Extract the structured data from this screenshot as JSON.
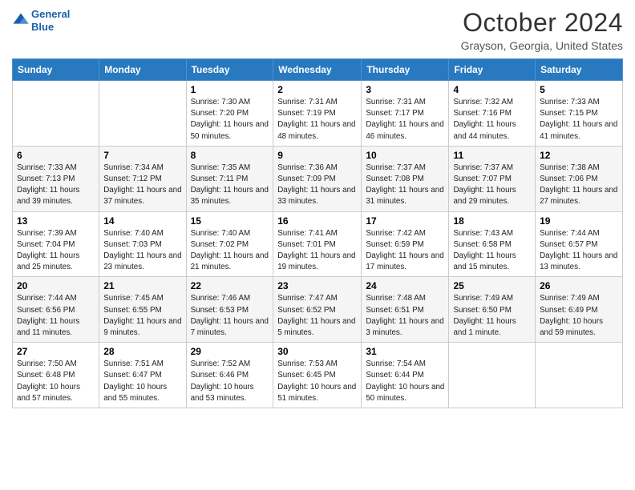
{
  "header": {
    "title": "October 2024",
    "location": "Grayson, Georgia, United States",
    "logo_line1": "General",
    "logo_line2": "Blue"
  },
  "days_of_week": [
    "Sunday",
    "Monday",
    "Tuesday",
    "Wednesday",
    "Thursday",
    "Friday",
    "Saturday"
  ],
  "weeks": [
    [
      {
        "day": "",
        "sunrise": "",
        "sunset": "",
        "daylight": ""
      },
      {
        "day": "",
        "sunrise": "",
        "sunset": "",
        "daylight": ""
      },
      {
        "day": "1",
        "sunrise": "Sunrise: 7:30 AM",
        "sunset": "Sunset: 7:20 PM",
        "daylight": "Daylight: 11 hours and 50 minutes."
      },
      {
        "day": "2",
        "sunrise": "Sunrise: 7:31 AM",
        "sunset": "Sunset: 7:19 PM",
        "daylight": "Daylight: 11 hours and 48 minutes."
      },
      {
        "day": "3",
        "sunrise": "Sunrise: 7:31 AM",
        "sunset": "Sunset: 7:17 PM",
        "daylight": "Daylight: 11 hours and 46 minutes."
      },
      {
        "day": "4",
        "sunrise": "Sunrise: 7:32 AM",
        "sunset": "Sunset: 7:16 PM",
        "daylight": "Daylight: 11 hours and 44 minutes."
      },
      {
        "day": "5",
        "sunrise": "Sunrise: 7:33 AM",
        "sunset": "Sunset: 7:15 PM",
        "daylight": "Daylight: 11 hours and 41 minutes."
      }
    ],
    [
      {
        "day": "6",
        "sunrise": "Sunrise: 7:33 AM",
        "sunset": "Sunset: 7:13 PM",
        "daylight": "Daylight: 11 hours and 39 minutes."
      },
      {
        "day": "7",
        "sunrise": "Sunrise: 7:34 AM",
        "sunset": "Sunset: 7:12 PM",
        "daylight": "Daylight: 11 hours and 37 minutes."
      },
      {
        "day": "8",
        "sunrise": "Sunrise: 7:35 AM",
        "sunset": "Sunset: 7:11 PM",
        "daylight": "Daylight: 11 hours and 35 minutes."
      },
      {
        "day": "9",
        "sunrise": "Sunrise: 7:36 AM",
        "sunset": "Sunset: 7:09 PM",
        "daylight": "Daylight: 11 hours and 33 minutes."
      },
      {
        "day": "10",
        "sunrise": "Sunrise: 7:37 AM",
        "sunset": "Sunset: 7:08 PM",
        "daylight": "Daylight: 11 hours and 31 minutes."
      },
      {
        "day": "11",
        "sunrise": "Sunrise: 7:37 AM",
        "sunset": "Sunset: 7:07 PM",
        "daylight": "Daylight: 11 hours and 29 minutes."
      },
      {
        "day": "12",
        "sunrise": "Sunrise: 7:38 AM",
        "sunset": "Sunset: 7:06 PM",
        "daylight": "Daylight: 11 hours and 27 minutes."
      }
    ],
    [
      {
        "day": "13",
        "sunrise": "Sunrise: 7:39 AM",
        "sunset": "Sunset: 7:04 PM",
        "daylight": "Daylight: 11 hours and 25 minutes."
      },
      {
        "day": "14",
        "sunrise": "Sunrise: 7:40 AM",
        "sunset": "Sunset: 7:03 PM",
        "daylight": "Daylight: 11 hours and 23 minutes."
      },
      {
        "day": "15",
        "sunrise": "Sunrise: 7:40 AM",
        "sunset": "Sunset: 7:02 PM",
        "daylight": "Daylight: 11 hours and 21 minutes."
      },
      {
        "day": "16",
        "sunrise": "Sunrise: 7:41 AM",
        "sunset": "Sunset: 7:01 PM",
        "daylight": "Daylight: 11 hours and 19 minutes."
      },
      {
        "day": "17",
        "sunrise": "Sunrise: 7:42 AM",
        "sunset": "Sunset: 6:59 PM",
        "daylight": "Daylight: 11 hours and 17 minutes."
      },
      {
        "day": "18",
        "sunrise": "Sunrise: 7:43 AM",
        "sunset": "Sunset: 6:58 PM",
        "daylight": "Daylight: 11 hours and 15 minutes."
      },
      {
        "day": "19",
        "sunrise": "Sunrise: 7:44 AM",
        "sunset": "Sunset: 6:57 PM",
        "daylight": "Daylight: 11 hours and 13 minutes."
      }
    ],
    [
      {
        "day": "20",
        "sunrise": "Sunrise: 7:44 AM",
        "sunset": "Sunset: 6:56 PM",
        "daylight": "Daylight: 11 hours and 11 minutes."
      },
      {
        "day": "21",
        "sunrise": "Sunrise: 7:45 AM",
        "sunset": "Sunset: 6:55 PM",
        "daylight": "Daylight: 11 hours and 9 minutes."
      },
      {
        "day": "22",
        "sunrise": "Sunrise: 7:46 AM",
        "sunset": "Sunset: 6:53 PM",
        "daylight": "Daylight: 11 hours and 7 minutes."
      },
      {
        "day": "23",
        "sunrise": "Sunrise: 7:47 AM",
        "sunset": "Sunset: 6:52 PM",
        "daylight": "Daylight: 11 hours and 5 minutes."
      },
      {
        "day": "24",
        "sunrise": "Sunrise: 7:48 AM",
        "sunset": "Sunset: 6:51 PM",
        "daylight": "Daylight: 11 hours and 3 minutes."
      },
      {
        "day": "25",
        "sunrise": "Sunrise: 7:49 AM",
        "sunset": "Sunset: 6:50 PM",
        "daylight": "Daylight: 11 hours and 1 minute."
      },
      {
        "day": "26",
        "sunrise": "Sunrise: 7:49 AM",
        "sunset": "Sunset: 6:49 PM",
        "daylight": "Daylight: 10 hours and 59 minutes."
      }
    ],
    [
      {
        "day": "27",
        "sunrise": "Sunrise: 7:50 AM",
        "sunset": "Sunset: 6:48 PM",
        "daylight": "Daylight: 10 hours and 57 minutes."
      },
      {
        "day": "28",
        "sunrise": "Sunrise: 7:51 AM",
        "sunset": "Sunset: 6:47 PM",
        "daylight": "Daylight: 10 hours and 55 minutes."
      },
      {
        "day": "29",
        "sunrise": "Sunrise: 7:52 AM",
        "sunset": "Sunset: 6:46 PM",
        "daylight": "Daylight: 10 hours and 53 minutes."
      },
      {
        "day": "30",
        "sunrise": "Sunrise: 7:53 AM",
        "sunset": "Sunset: 6:45 PM",
        "daylight": "Daylight: 10 hours and 51 minutes."
      },
      {
        "day": "31",
        "sunrise": "Sunrise: 7:54 AM",
        "sunset": "Sunset: 6:44 PM",
        "daylight": "Daylight: 10 hours and 50 minutes."
      },
      {
        "day": "",
        "sunrise": "",
        "sunset": "",
        "daylight": ""
      },
      {
        "day": "",
        "sunrise": "",
        "sunset": "",
        "daylight": ""
      }
    ]
  ]
}
